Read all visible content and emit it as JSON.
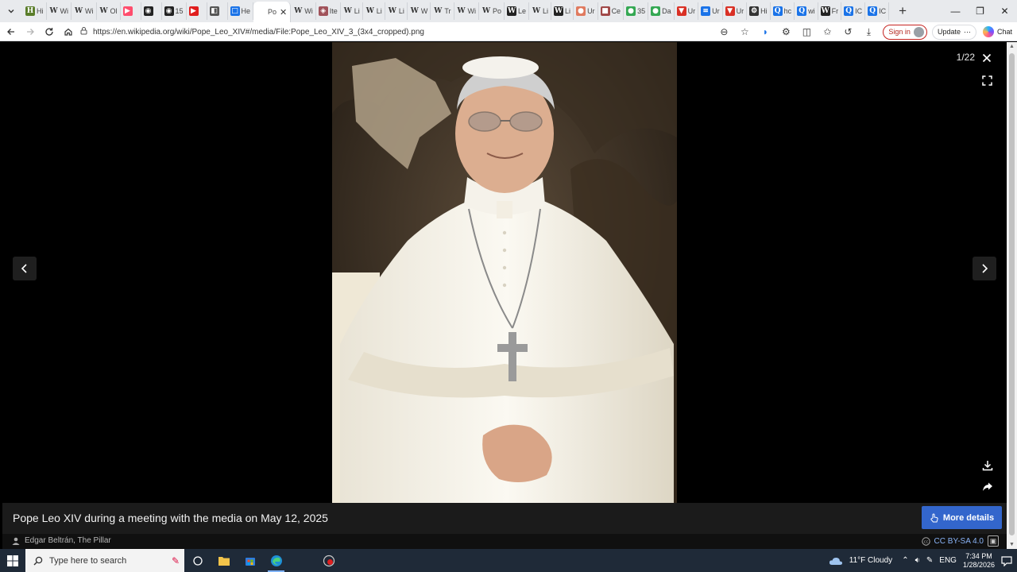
{
  "browser": {
    "tabs": [
      {
        "label": "Hi",
        "fav": "H",
        "color": "#5a7d2a"
      },
      {
        "label": "Wi",
        "fav": "W",
        "color": "#bbbbbb"
      },
      {
        "label": "Wi",
        "fav": "W",
        "color": "#bbbbbb"
      },
      {
        "label": "Ol",
        "fav": "W",
        "color": "#bbbbbb"
      },
      {
        "label": "",
        "fav": "▶",
        "color": "#ff4d6d"
      },
      {
        "label": "",
        "fav": "◉",
        "color": "#222222"
      },
      {
        "label": "15",
        "fav": "◉",
        "color": "#222222"
      },
      {
        "label": "",
        "fav": "▶",
        "color": "#e01e1e"
      },
      {
        "label": "",
        "fav": "◧",
        "color": "#555555"
      },
      {
        "label": "He",
        "fav": "□",
        "color": "#1a73e8"
      },
      {
        "label": "Po",
        "fav": "",
        "color": "#ffffff",
        "active": true
      },
      {
        "label": "Wi",
        "fav": "W",
        "color": "#bbbbbb"
      },
      {
        "label": "Ite",
        "fav": "◈",
        "color": "#a0525a"
      },
      {
        "label": "Li",
        "fav": "W",
        "color": "#bbbbbb"
      },
      {
        "label": "Li",
        "fav": "W",
        "color": "#bbbbbb"
      },
      {
        "label": "Li",
        "fav": "W",
        "color": "#bbbbbb"
      },
      {
        "label": "W",
        "fav": "W",
        "color": "#bbbbbb"
      },
      {
        "label": "Tr",
        "fav": "W",
        "color": "#bbbbbb"
      },
      {
        "label": "Wi",
        "fav": "W",
        "color": "#bbbbbb"
      },
      {
        "label": "Po",
        "fav": "W",
        "color": "#bbbbbb"
      },
      {
        "label": "Le",
        "fav": "W",
        "color": "#222222"
      },
      {
        "label": "Li",
        "fav": "W",
        "color": "#bbbbbb"
      },
      {
        "label": "Li",
        "fav": "W",
        "color": "#222222"
      },
      {
        "label": "Ur",
        "fav": "●",
        "color": "#e07a5f"
      },
      {
        "label": "Ce",
        "fav": "■",
        "color": "#a04848"
      },
      {
        "label": "35",
        "fav": "●",
        "color": "#34a853"
      },
      {
        "label": "Da",
        "fav": "●",
        "color": "#34a853"
      },
      {
        "label": "Ur",
        "fav": "▼",
        "color": "#d93025"
      },
      {
        "label": "Ur",
        "fav": "≡",
        "color": "#1a73e8"
      },
      {
        "label": "Ur",
        "fav": "▼",
        "color": "#d93025"
      },
      {
        "label": "Hi",
        "fav": "⚙",
        "color": "#333333"
      },
      {
        "label": "hc",
        "fav": "Q",
        "color": "#1a73e8"
      },
      {
        "label": "wi",
        "fav": "Q",
        "color": "#1a73e8"
      },
      {
        "label": "Fr",
        "fav": "W",
        "color": "#222222"
      },
      {
        "label": "IC",
        "fav": "Q",
        "color": "#1a73e8"
      },
      {
        "label": "IC",
        "fav": "Q",
        "color": "#1a73e8"
      }
    ],
    "url": "https://en.wikipedia.org/wiki/Pope_Leo_XIV#/media/File:Pope_Leo_XIV_3_(3x4_cropped).png",
    "signin_label": "Sign in",
    "update_label": "Update",
    "chat_label": "Chat"
  },
  "viewer": {
    "counter": "1/22",
    "caption": "Pope Leo XIV during a meeting with the media on May 12, 2025",
    "more_details_label": "More details",
    "author": "Edgar Beltrán, The Pillar",
    "license": "CC BY-SA 4.0"
  },
  "taskbar": {
    "search_placeholder": "Type here to search",
    "weather": "11°F  Cloudy",
    "language": "ENG",
    "time": "7:34 PM",
    "date": "1/28/2026"
  },
  "colors": {
    "accent_button": "#3366cc",
    "taskbar_bg": "#1f2a38"
  }
}
